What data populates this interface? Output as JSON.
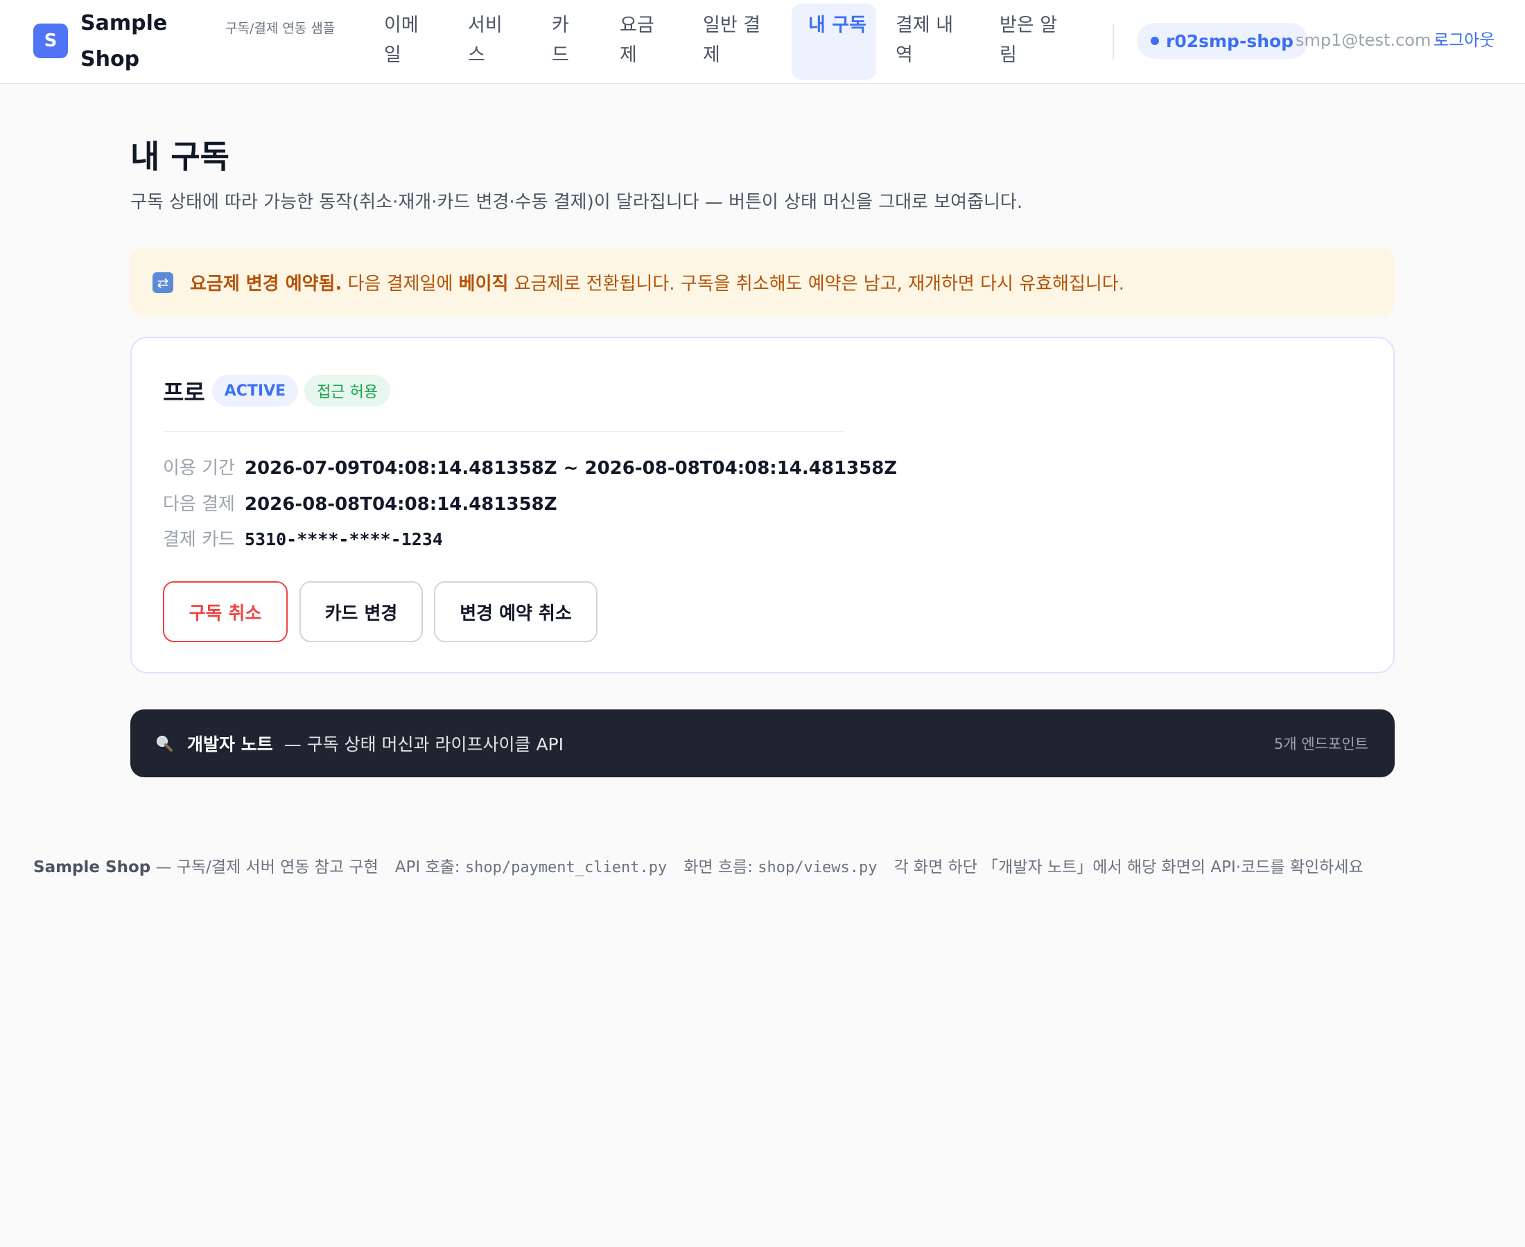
{
  "header": {
    "logo_letter": "S",
    "brand": "Sample Shop",
    "tagline": "구독/결제 연동 샘플",
    "nav": [
      {
        "label": "이메일",
        "active": false
      },
      {
        "label": "서비스",
        "active": false
      },
      {
        "label": "카드",
        "active": false
      },
      {
        "label": "요금제",
        "active": false
      },
      {
        "label": "일반 결제",
        "active": false
      },
      {
        "label": "내 구독",
        "active": true
      },
      {
        "label": "결제 내역",
        "active": false
      },
      {
        "label": "받은 알림",
        "active": false
      }
    ],
    "shop_id": "r02smp-shop",
    "user_email": "smp1@test.com ·",
    "logout": "로그아웃"
  },
  "page": {
    "title": "내 구독",
    "description": "구독 상태에 따라 가능한 동작(취소·재개·카드 변경·수동 결제)이 달라집니다 — 버튼이 상태 머신을 그대로 보여줍니다."
  },
  "notice": {
    "icon": "refresh-icon",
    "bold_lead": "요금제 변경 예약됨.",
    "text_1": " 다음 결제일에 ",
    "plan_bold": "베이직",
    "text_2": " 요금제로 전환됩니다. 구독을 취소해도 예약은 남고, 재개하면 다시 유효해집니다."
  },
  "subscription": {
    "plan": "프로",
    "status": "ACTIVE",
    "access": "접근 허용",
    "period_label": "이용 기간",
    "period_value": "2026-07-09T04:08:14.481358Z ~ 2026-08-08T04:08:14.481358Z",
    "next_label": "다음 결제",
    "next_value": "2026-08-08T04:08:14.481358Z",
    "card_label": "결제 카드",
    "card_value": "5310-****-****-1234",
    "actions": {
      "cancel": "구독 취소",
      "change_card": "카드 변경",
      "cancel_change": "변경 예약 취소"
    }
  },
  "devnote": {
    "icon": "magnifier-icon",
    "title": "개발자 노트",
    "subtitle": "— 구독 상태 머신과 라이프사이클 API",
    "count": "5개 엔드포인트"
  },
  "footer": {
    "brand": "Sample Shop",
    "brand_desc": " — 구독/결제 서버 연동 참고 구현",
    "api_label": "API 호출: ",
    "api_file": "shop/payment_client.py",
    "flow_label": "화면 흐름: ",
    "flow_file": "shop/views.py",
    "hint": "각 화면 하단 「개발자 노트」에서 해당 화면의 API·코드를 확인하세요"
  },
  "colors": {
    "accent": "#3b6ff5",
    "logo": "#4f74f5",
    "danger": "#ef4444",
    "notice_bg": "#fef6e4",
    "notice_text": "#b45309",
    "success": "#16a34a",
    "dark_panel": "#1f2430"
  }
}
